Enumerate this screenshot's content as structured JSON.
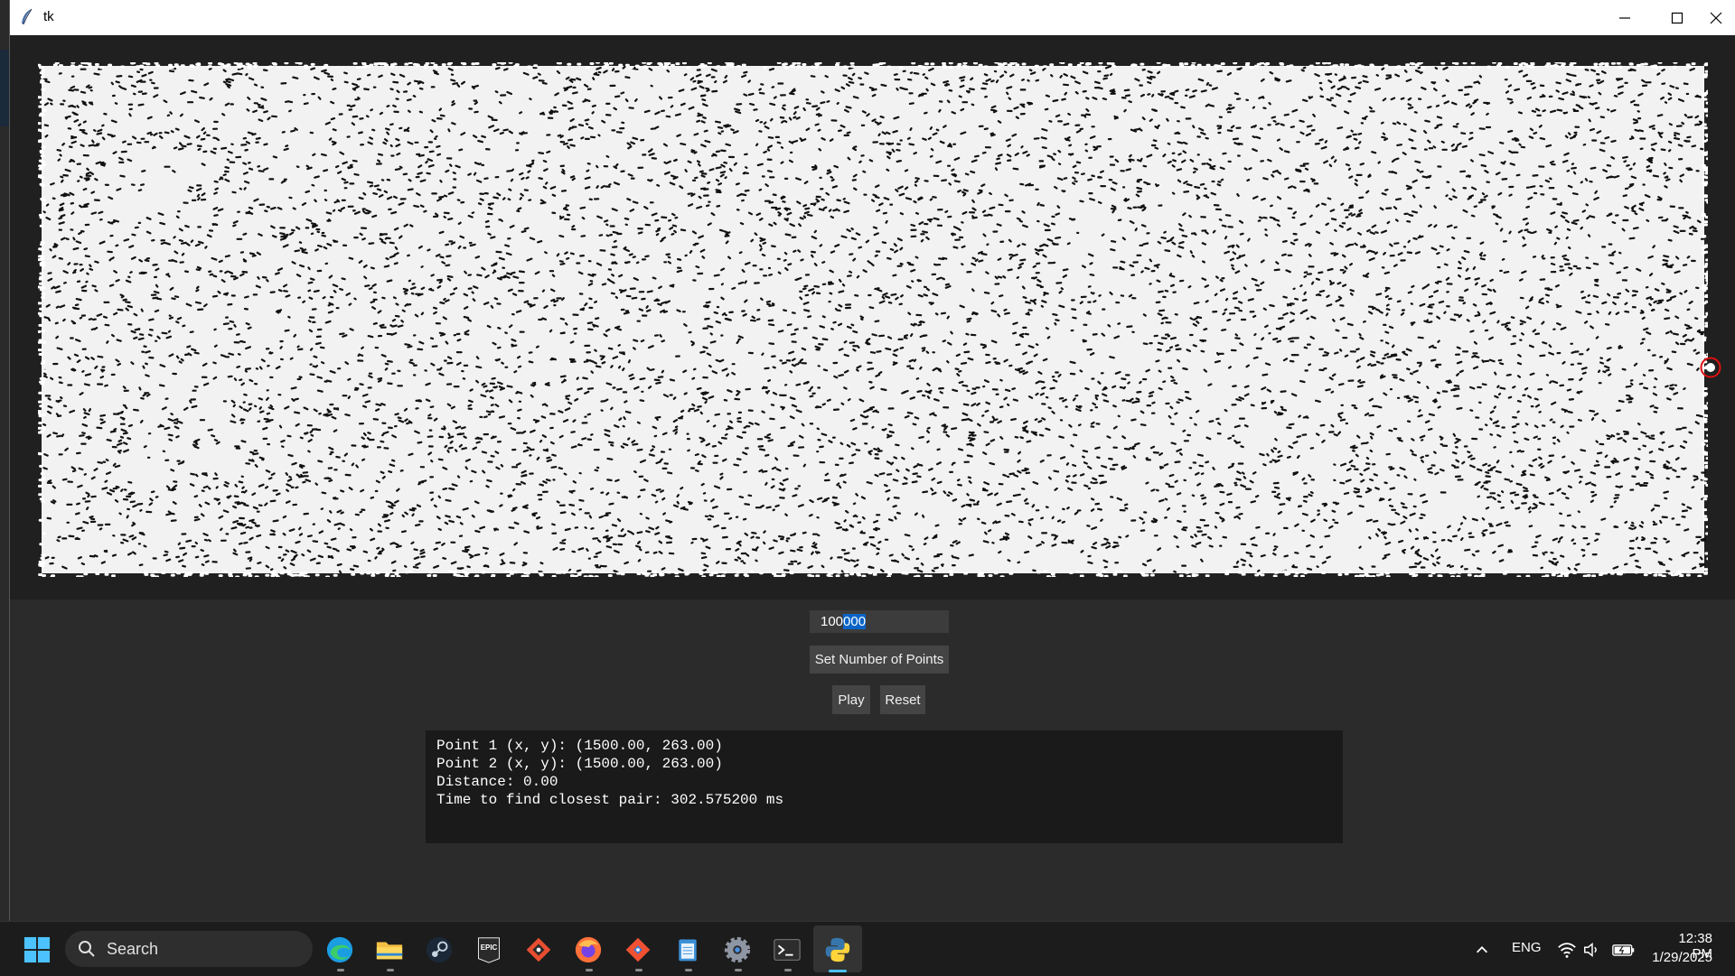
{
  "window": {
    "title": "tk"
  },
  "controls": {
    "point_count_value": "100000",
    "point_count_plain": "100",
    "point_count_selected": "000",
    "set_points_label": "Set Number of Points",
    "play_label": "Play",
    "reset_label": "Reset"
  },
  "output": {
    "lines": [
      "Point 1 (x, y): (1500.00, 263.00)",
      "Point 2 (x, y): (1500.00, 263.00)",
      "Distance: 0.00",
      "Time to find closest pair: 302.575200 ms"
    ]
  },
  "colors": {
    "highlight": "#e01010",
    "input_selection": "#0a64c8",
    "points": "#ffffff"
  },
  "taskbar": {
    "search_label": "Search",
    "apps": [
      "windows-start-icon",
      "edge-icon",
      "file-explorer-icon",
      "steam-icon",
      "epic-games-icon",
      "git-icon",
      "firefox-icon",
      "git-gui-icon",
      "notepad-icon",
      "settings-icon",
      "terminal-icon",
      "python-icon"
    ],
    "epic_logo_text": "EPIC",
    "language": "ENG",
    "time": "12:38 PM",
    "date": "1/29/2025"
  }
}
